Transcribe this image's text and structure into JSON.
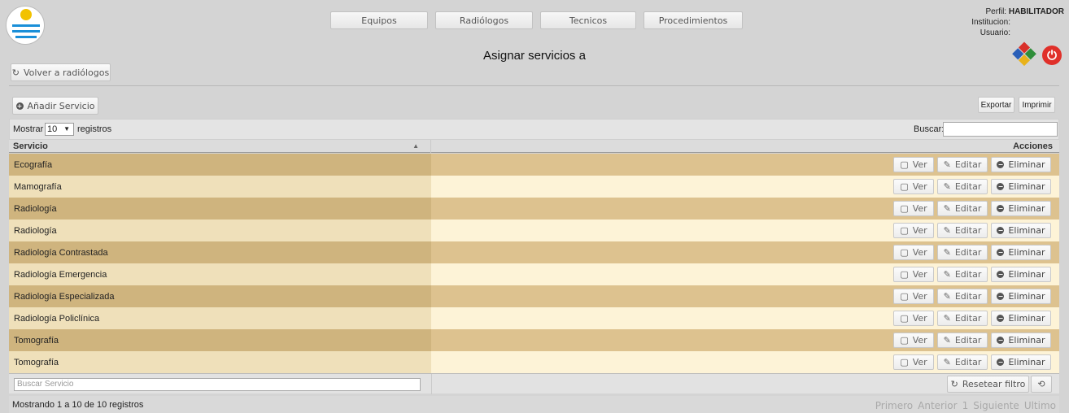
{
  "header": {
    "nav": [
      {
        "label": "Equipos"
      },
      {
        "label": "Radiólogos"
      },
      {
        "label": "Tecnicos"
      },
      {
        "label": "Procedimientos"
      }
    ],
    "profile": {
      "perfil_label": "Perfil:",
      "perfil_value": "HABILITADOR",
      "institucion_label": "Institucion:",
      "usuario_label": "Usuario:"
    },
    "logout_icon": "power-icon",
    "group_icon": "users-group-icon"
  },
  "page": {
    "title": "Asignar servicios a",
    "back_label": "Volver a radiólogos",
    "add_label": "Añadir Servicio",
    "export_label": "Exportar",
    "print_label": "Imprimir"
  },
  "table": {
    "length_prefix": "Mostrar",
    "length_value": "10",
    "length_suffix": "registros",
    "search_label": "Buscar:",
    "columns": [
      "Servicio",
      "Acciones"
    ],
    "action_labels": {
      "view": "Ver",
      "edit": "Editar",
      "delete": "Eliminar"
    },
    "rows": [
      {
        "service": "Ecografía"
      },
      {
        "service": "Mamografía"
      },
      {
        "service": "Radiología"
      },
      {
        "service": "Radiología"
      },
      {
        "service": "Radiología Contrastada"
      },
      {
        "service": "Radiología Emergencia"
      },
      {
        "service": "Radiología Especializada"
      },
      {
        "service": "Radiología Policlínica"
      },
      {
        "service": "Tomografía"
      },
      {
        "service": "Tomografía"
      }
    ],
    "filter_placeholder": "Buscar Servicio",
    "reset_label": "Resetear filtro",
    "info": "Mostrando 1 a 10 de 10 registros",
    "pager": [
      "Primero",
      "Anterior",
      "1",
      "Siguiente",
      "Ultimo"
    ]
  },
  "colors": {
    "row_odd_left": "#cfb47e",
    "row_odd_right": "#ddc28f",
    "row_even_left": "#efe0ba",
    "row_even_right": "#fdf3d7",
    "logout_red": "#e0302a"
  }
}
